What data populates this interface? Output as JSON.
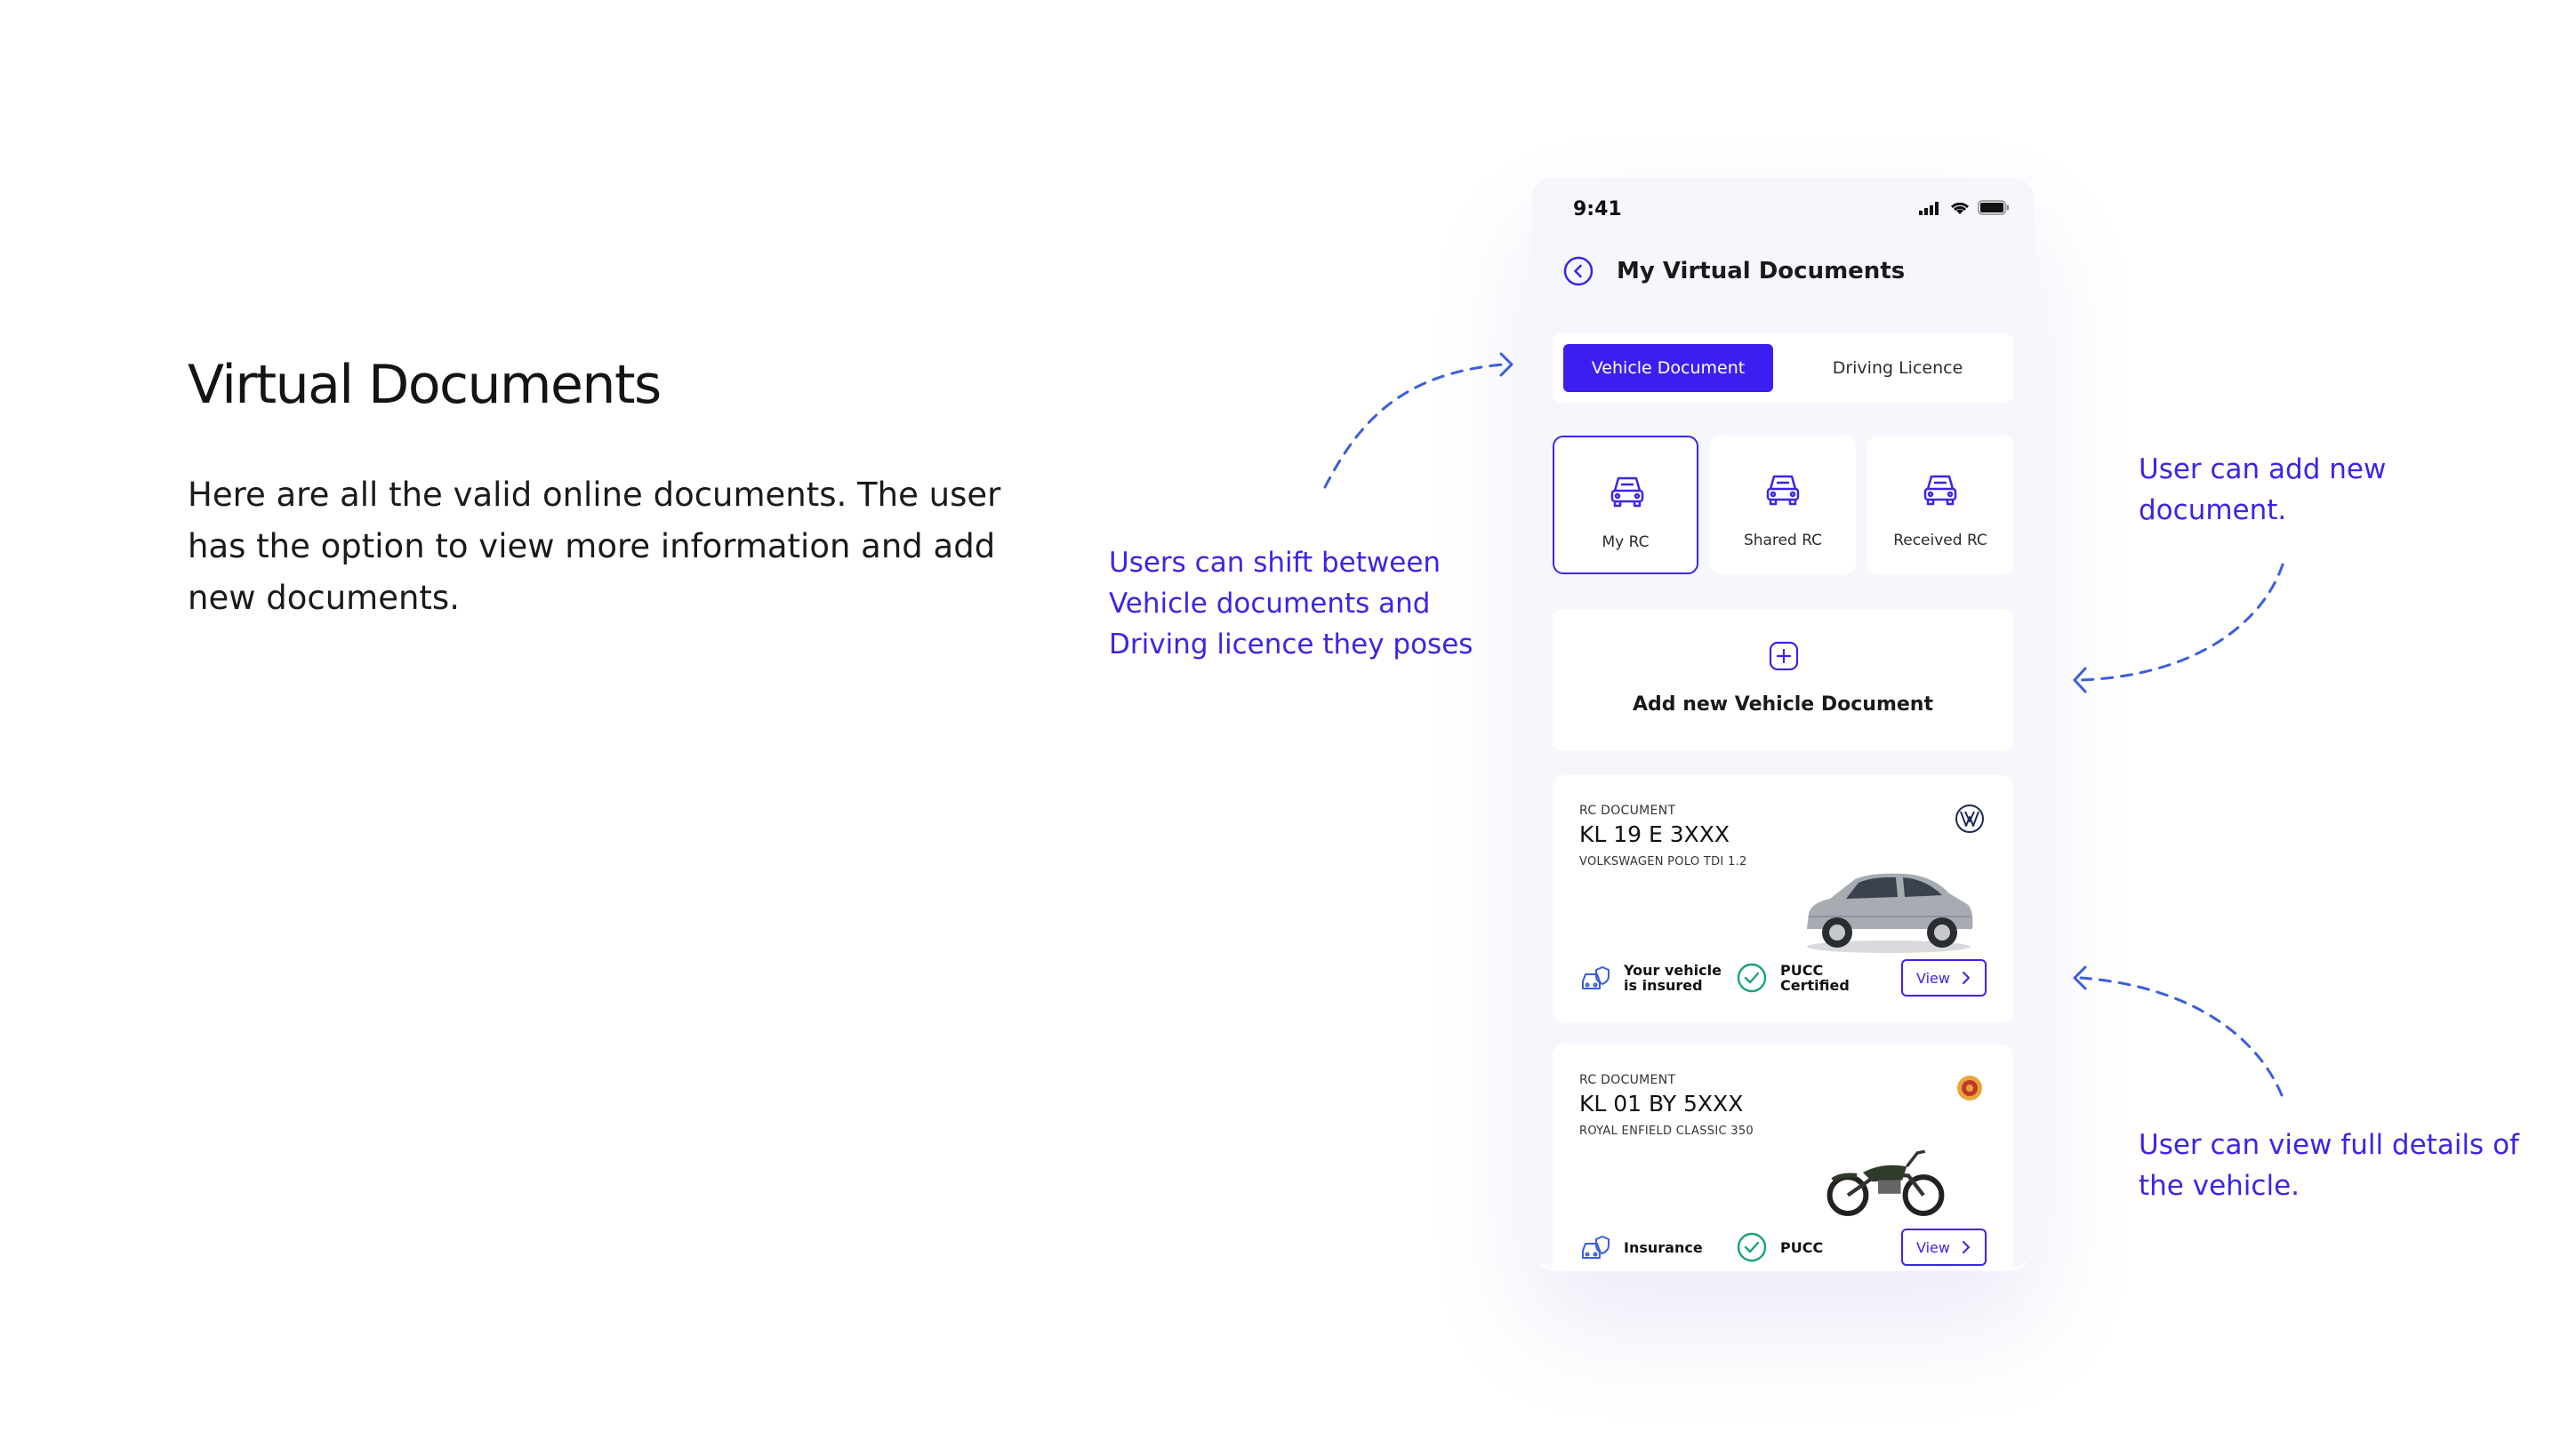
{
  "intro": {
    "title": "Virtual Documents",
    "text": "Here are all the valid online documents. The user has the option to view more information and add new documents."
  },
  "annotations": {
    "tabs_note": "Users can shift between Vehicle documents and Driving licence they poses",
    "add_note": "User can add new document.",
    "view_note": "User can view full details of the vehicle."
  },
  "phone": {
    "status_time": "9:41",
    "header_title": "My Virtual Documents",
    "tabs": [
      {
        "label": "Vehicle Document",
        "active": true
      },
      {
        "label": "Driving Licence",
        "active": false
      }
    ],
    "rc_tiles": [
      {
        "label": "My RC",
        "selected": true
      },
      {
        "label": "Shared RC",
        "selected": false
      },
      {
        "label": "Received RC",
        "selected": false
      }
    ],
    "add_label": "Add new Vehicle Document",
    "vehicles": [
      {
        "tag": "RC DOCUMENT",
        "plate": "KL 19 E 3XXX",
        "model": "VOLKSWAGEN POLO TDI 1.2",
        "status_1": "Your vehicle is insured",
        "status_2": "PUCC Certified",
        "view_label": "View"
      },
      {
        "tag": "RC DOCUMENT",
        "plate": "KL 01 BY 5XXX",
        "model": "ROYAL ENFIELD CLASSIC 350",
        "status_1": "Insurance",
        "status_2": "PUCC",
        "view_label": "View"
      }
    ]
  },
  "colors": {
    "accent": "#3b25e6",
    "accent_tab": "#3b1ff0",
    "success": "#1aa37a",
    "phone_bg": "#f5f7fc"
  },
  "icons": [
    "back-icon",
    "signal-icon",
    "wifi-icon",
    "battery-icon",
    "car-front-icon",
    "plus-icon",
    "volkswagen-logo",
    "royal-enfield-logo",
    "insurance-icon",
    "check-circle-icon",
    "chevron-right-icon"
  ]
}
